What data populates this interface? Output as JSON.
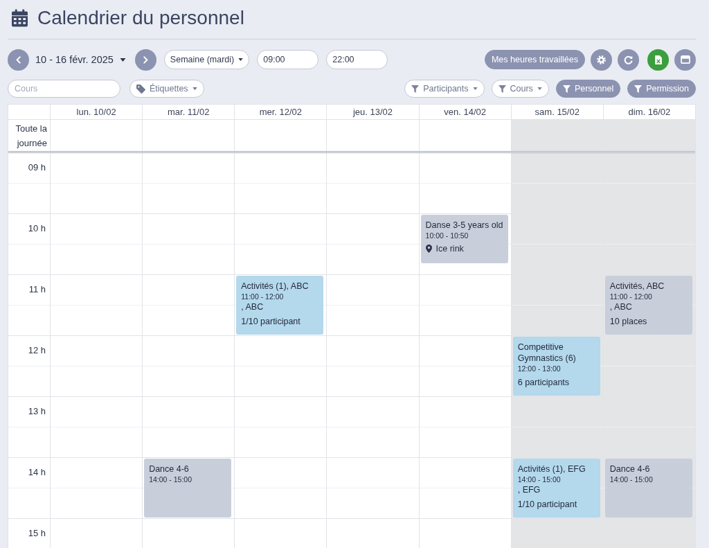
{
  "header": {
    "title": "Calendrier du personnel"
  },
  "toolbar": {
    "date_range": "10 - 16 févr. 2025",
    "view": "Semaine (mardi)",
    "start_time": "09:00",
    "end_time": "22:00",
    "worked_hours": "Mes heures travaillées"
  },
  "filters": {
    "course_search": {
      "placeholder": "Cours"
    },
    "tags": "Étiquettes",
    "buttons": [
      {
        "label": "Participants",
        "kind": "dropdown",
        "active": false
      },
      {
        "label": "Cours",
        "kind": "dropdown",
        "active": false
      },
      {
        "label": "Personnel",
        "kind": "toggle",
        "active": true
      },
      {
        "label": "Permission",
        "kind": "toggle",
        "active": true
      }
    ]
  },
  "calendar": {
    "all_day_label": "Toute la journée",
    "hours": [
      "09 h",
      "10 h",
      "11 h",
      "12 h",
      "13 h",
      "14 h",
      "15 h"
    ],
    "days": [
      {
        "label": "lun. 10/02",
        "weekend": false
      },
      {
        "label": "mar. 11/02",
        "weekend": false,
        "events": [
          {
            "title": "Dance 4-6",
            "time": "14:00 - 15:00",
            "color": "#c9cedb"
          }
        ]
      },
      {
        "label": "mer. 12/02",
        "weekend": false,
        "events": [
          {
            "title": "Activités (1), ABC",
            "time": "11:00 - 12:00",
            "subtitle": ", ABC",
            "count": "1/10 participant",
            "color": "#b4d8ec"
          }
        ]
      },
      {
        "label": "jeu. 13/02",
        "weekend": false
      },
      {
        "label": "ven. 14/02",
        "weekend": false,
        "events": [
          {
            "title": "Danse 3-5 years old",
            "time": "10:00 - 10:50",
            "location": "Ice rink",
            "color": "#c9cedb"
          }
        ]
      },
      {
        "label": "sam. 15/02",
        "weekend": true,
        "events": [
          {
            "title": "Competitive Gymnastics (6)",
            "time": "12:00 - 13:00",
            "count": "6 participants",
            "color": "#b4d8ec"
          },
          {
            "title": "Activités (1), EFG",
            "time": "14:00 - 15:00",
            "subtitle": ", EFG",
            "count": "1/10 participant",
            "color": "#b4d8ec"
          }
        ]
      },
      {
        "label": "dim. 16/02",
        "weekend": true,
        "events": [
          {
            "title": "Activités, ABC",
            "time": "11:00 - 12:00",
            "subtitle": ", ABC",
            "count": "10 places",
            "color": "#c9cedb"
          },
          {
            "title": "Dance 4-6",
            "time": "14:00 - 15:00",
            "color": "#c9cedb"
          }
        ]
      }
    ]
  }
}
